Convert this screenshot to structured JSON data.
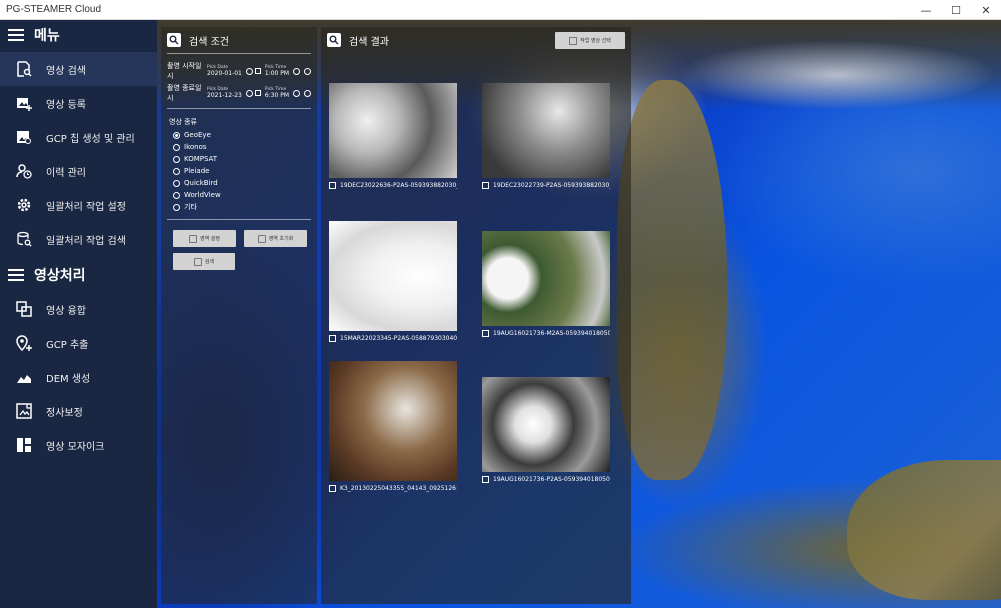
{
  "window": {
    "title": "PG-STEAMER Cloud",
    "minimize": "—",
    "maximize": "☐",
    "close": "✕"
  },
  "sidebar": {
    "menu_label": "메뉴",
    "menu_items": [
      {
        "label": "영상 검색",
        "icon": "image-search-icon",
        "active": true
      },
      {
        "label": "영상 등록",
        "icon": "image-add-icon",
        "active": false
      },
      {
        "label": "GCP 칩 생성 및 관리",
        "icon": "gcp-chip-icon",
        "active": false
      },
      {
        "label": "이력 관리",
        "icon": "history-icon",
        "active": false
      },
      {
        "label": "일괄처리 작업 설정",
        "icon": "gear-icon",
        "active": false
      },
      {
        "label": "일괄처리 작업 검색",
        "icon": "batch-search-icon",
        "active": false
      }
    ],
    "processing_label": "영상처리",
    "processing_items": [
      {
        "label": "영상 융합",
        "icon": "fusion-icon"
      },
      {
        "label": "GCP 추출",
        "icon": "location-pin-icon"
      },
      {
        "label": "DEM 생성",
        "icon": "terrain-icon"
      },
      {
        "label": "정사보정",
        "icon": "ortho-icon"
      },
      {
        "label": "영상 모자이크",
        "icon": "mosaic-icon"
      }
    ]
  },
  "search": {
    "title": "검색 조건",
    "start": {
      "label": "촬영 시작일시",
      "date_cap": "Pick Date",
      "date": "2020-01-01",
      "time_cap": "Pick Time",
      "time": "1:00 PM"
    },
    "end": {
      "label": "촬영 종료일시",
      "date_cap": "Pick Date",
      "date": "2021-12-23",
      "time_cap": "Pick Time",
      "time": "6:30 PM"
    },
    "sat_title": "영상 종류",
    "satellites": [
      {
        "name": "GeoEye",
        "selected": true
      },
      {
        "name": "Ikonos",
        "selected": false
      },
      {
        "name": "KOMPSAT",
        "selected": false
      },
      {
        "name": "Pleiade",
        "selected": false
      },
      {
        "name": "QuickBird",
        "selected": false
      },
      {
        "name": "WorldView",
        "selected": false
      },
      {
        "name": "기타",
        "selected": false
      }
    ],
    "btn_area_set": "영역 설정",
    "btn_area_reset": "영역 초기화",
    "btn_search": "검색"
  },
  "results": {
    "title": "검색 결과",
    "select_btn": "작업 영상 선택",
    "items": [
      {
        "caption": "19DEC23022636-P2AS-059393882030_",
        "style": "img-gray1"
      },
      {
        "caption": "19DEC23022739-P2AS-059393882030_",
        "style": "img-gray2"
      },
      {
        "caption": "15MAR22023345-P2AS-058879303040_",
        "style": "img-white"
      },
      {
        "caption": "19AUG16021736-M2AS-059394018050_",
        "style": "img-green"
      },
      {
        "caption": "K3_20130225043355_04143_09251261_",
        "style": "img-brown"
      },
      {
        "caption": "19AUG16021736-P2AS-059394018050_(",
        "style": "img-bw"
      }
    ]
  }
}
